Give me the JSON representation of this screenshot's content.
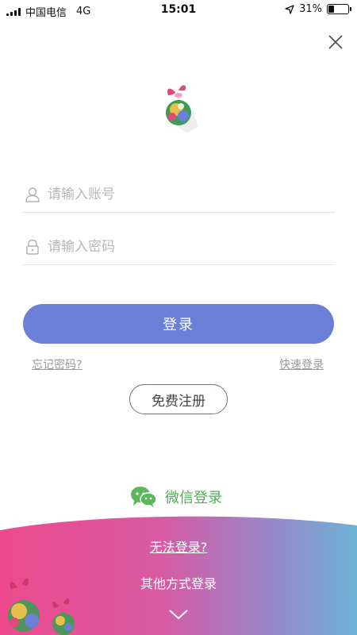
{
  "status": {
    "carrier": "中国电信",
    "network": "4G",
    "time": "15:01",
    "battery": "31%",
    "battery_level": 0.31
  },
  "form": {
    "account_placeholder": "请输入账号",
    "password_placeholder": "请输入密码",
    "account_value": "",
    "password_value": ""
  },
  "actions": {
    "login_label": "登录",
    "forgot_password": "忘记密码?",
    "quick_login": "快速登录",
    "register_label": "免费注册",
    "wechat_login": "微信登录",
    "cannot_login": "无法登录?",
    "other_ways": "其他方式登录"
  },
  "icons": {
    "close": "close-icon",
    "user": "user-icon",
    "lock": "lock-icon",
    "wechat": "wechat-icon",
    "expand": "chevron-down-icon",
    "location": "location-arrow-icon"
  },
  "colors": {
    "primary": "#6b7fd6",
    "wechat": "#4caf50",
    "gradient_start": "#e94c8f",
    "gradient_end": "#6fb0d8"
  }
}
